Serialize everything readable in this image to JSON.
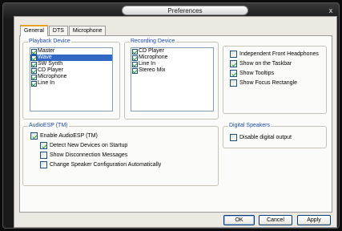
{
  "window": {
    "title": "Preferences",
    "close_glyph": "x"
  },
  "tabs": [
    {
      "label": "General",
      "active": true
    },
    {
      "label": "DTS",
      "active": false
    },
    {
      "label": "Microphone",
      "active": false
    }
  ],
  "playback": {
    "label": "Playback Device",
    "items": [
      {
        "label": "Master",
        "checked": true,
        "selected": false
      },
      {
        "label": "Wave",
        "checked": true,
        "selected": true
      },
      {
        "label": "SW Synth",
        "checked": true,
        "selected": false
      },
      {
        "label": "CD Player",
        "checked": true,
        "selected": false
      },
      {
        "label": "Microphone",
        "checked": true,
        "selected": false
      },
      {
        "label": "Line In",
        "checked": true,
        "selected": false
      }
    ]
  },
  "recording": {
    "label": "Recording Device",
    "items": [
      {
        "label": "CD Player",
        "checked": true
      },
      {
        "label": "Microphone",
        "checked": true
      },
      {
        "label": "Line In",
        "checked": true
      },
      {
        "label": "Stereo Mix",
        "checked": true
      }
    ]
  },
  "options": [
    {
      "label": "Independent Front Headphones",
      "checked": false
    },
    {
      "label": "Show on the Taskbar",
      "checked": true
    },
    {
      "label": "Show Tooltips",
      "checked": true
    },
    {
      "label": "Show Focus Rectangle",
      "checked": false
    }
  ],
  "audioesp": {
    "label": "AudioESP (TM)",
    "enable": {
      "label": "Enable AudioESP (TM)",
      "checked": true
    },
    "detect": {
      "label": "Detect New Devices on Startup",
      "checked": true
    },
    "disconnect": {
      "label": "Show Disconnection Messages",
      "checked": false
    },
    "change_config": {
      "label": "Change Speaker Configuration Automatically",
      "checked": false
    }
  },
  "digital": {
    "label": "Digital Speakers",
    "disable": {
      "label": "Disable digital output",
      "checked": false
    }
  },
  "buttons": {
    "ok": "OK",
    "cancel": "Cancel",
    "apply": "Apply"
  },
  "colors": {
    "group_label": "#1b4aa8",
    "selection": "#3168c6",
    "check": "#21a121",
    "tab_accent": "#e5a128"
  }
}
